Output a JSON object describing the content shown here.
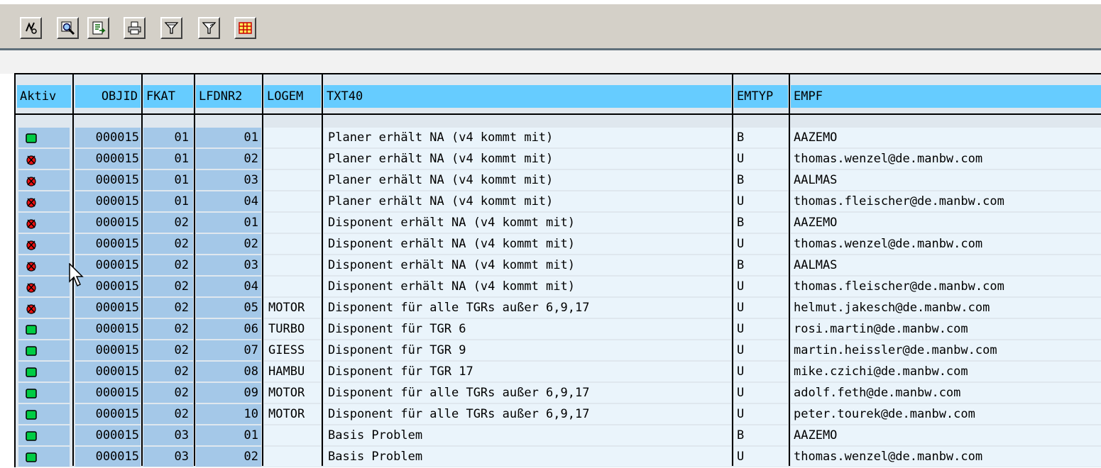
{
  "toolbar": {
    "buttons": [
      {
        "icon": "details-icon"
      },
      {
        "icon": "find-icon"
      },
      {
        "icon": "export-icon"
      },
      {
        "icon": "print-icon"
      },
      {
        "icon": "sort-icon"
      },
      {
        "icon": "filter-icon"
      },
      {
        "icon": "layout-grid-icon"
      }
    ]
  },
  "table": {
    "columns": [
      "Aktiv",
      "OBJID",
      "FKAT",
      "LFDNR2",
      "LOGEM",
      "TXT40",
      "EMTYP",
      "EMPF"
    ],
    "rows": [
      {
        "aktiv": "green",
        "objid": "000015",
        "fkat": "01",
        "lfdnr2": "01",
        "logem": "",
        "txt40": "Planer erhält NA (v4 kommt mit)",
        "emtyp": "B",
        "empf": "AAZEMO"
      },
      {
        "aktiv": "red",
        "objid": "000015",
        "fkat": "01",
        "lfdnr2": "02",
        "logem": "",
        "txt40": "Planer erhält NA (v4 kommt mit)",
        "emtyp": "U",
        "empf": "thomas.wenzel@de.manbw.com"
      },
      {
        "aktiv": "red",
        "objid": "000015",
        "fkat": "01",
        "lfdnr2": "03",
        "logem": "",
        "txt40": "Planer erhält NA (v4 kommt mit)",
        "emtyp": "B",
        "empf": "AALMAS"
      },
      {
        "aktiv": "red",
        "objid": "000015",
        "fkat": "01",
        "lfdnr2": "04",
        "logem": "",
        "txt40": "Planer erhält NA (v4 kommt mit)",
        "emtyp": "U",
        "empf": "thomas.fleischer@de.manbw.com"
      },
      {
        "aktiv": "red",
        "objid": "000015",
        "fkat": "02",
        "lfdnr2": "01",
        "logem": "",
        "txt40": "Disponent erhält NA (v4 kommt mit)",
        "emtyp": "B",
        "empf": "AAZEMO"
      },
      {
        "aktiv": "red",
        "objid": "000015",
        "fkat": "02",
        "lfdnr2": "02",
        "logem": "",
        "txt40": "Disponent erhält NA (v4 kommt mit)",
        "emtyp": "U",
        "empf": "thomas.wenzel@de.manbw.com"
      },
      {
        "aktiv": "red",
        "objid": "000015",
        "fkat": "02",
        "lfdnr2": "03",
        "logem": "",
        "txt40": "Disponent erhält NA (v4 kommt mit)",
        "emtyp": "B",
        "empf": "AALMAS"
      },
      {
        "aktiv": "red",
        "objid": "000015",
        "fkat": "02",
        "lfdnr2": "04",
        "logem": "",
        "txt40": "Disponent erhält NA (v4 kommt mit)",
        "emtyp": "U",
        "empf": "thomas.fleischer@de.manbw.com"
      },
      {
        "aktiv": "red",
        "objid": "000015",
        "fkat": "02",
        "lfdnr2": "05",
        "logem": "MOTOR",
        "txt40": "Disponent für alle TGRs außer 6,9,17",
        "emtyp": "U",
        "empf": "helmut.jakesch@de.manbw.com"
      },
      {
        "aktiv": "green",
        "objid": "000015",
        "fkat": "02",
        "lfdnr2": "06",
        "logem": "TURBO",
        "txt40": "Disponent für TGR 6",
        "emtyp": "U",
        "empf": "rosi.martin@de.manbw.com"
      },
      {
        "aktiv": "green",
        "objid": "000015",
        "fkat": "02",
        "lfdnr2": "07",
        "logem": "GIESS",
        "txt40": "Disponent für TGR 9",
        "emtyp": "U",
        "empf": "martin.heissler@de.manbw.com"
      },
      {
        "aktiv": "green",
        "objid": "000015",
        "fkat": "02",
        "lfdnr2": "08",
        "logem": "HAMBU",
        "txt40": "Disponent für TGR 17",
        "emtyp": "U",
        "empf": "mike.czichi@de.manbw.com"
      },
      {
        "aktiv": "green",
        "objid": "000015",
        "fkat": "02",
        "lfdnr2": "09",
        "logem": "MOTOR",
        "txt40": "Disponent für alle TGRs außer 6,9,17",
        "emtyp": "U",
        "empf": "adolf.feth@de.manbw.com"
      },
      {
        "aktiv": "green",
        "objid": "000015",
        "fkat": "02",
        "lfdnr2": "10",
        "logem": "MOTOR",
        "txt40": "Disponent für alle TGRs außer 6,9,17",
        "emtyp": "U",
        "empf": "peter.tourek@de.manbw.com"
      },
      {
        "aktiv": "green",
        "objid": "000015",
        "fkat": "03",
        "lfdnr2": "01",
        "logem": "",
        "txt40": "Basis Problem",
        "emtyp": "B",
        "empf": "AAZEMO"
      },
      {
        "aktiv": "green",
        "objid": "000015",
        "fkat": "03",
        "lfdnr2": "02",
        "logem": "",
        "txt40": "Basis Problem",
        "emtyp": "U",
        "empf": "thomas.wenzel@de.manbw.com"
      }
    ]
  },
  "colors": {
    "header": "#66ccff",
    "key_cell": "#a4c8e8",
    "data_cell": "#eaf4fb",
    "active": "#00cc44",
    "inactive": "#ee1111"
  }
}
